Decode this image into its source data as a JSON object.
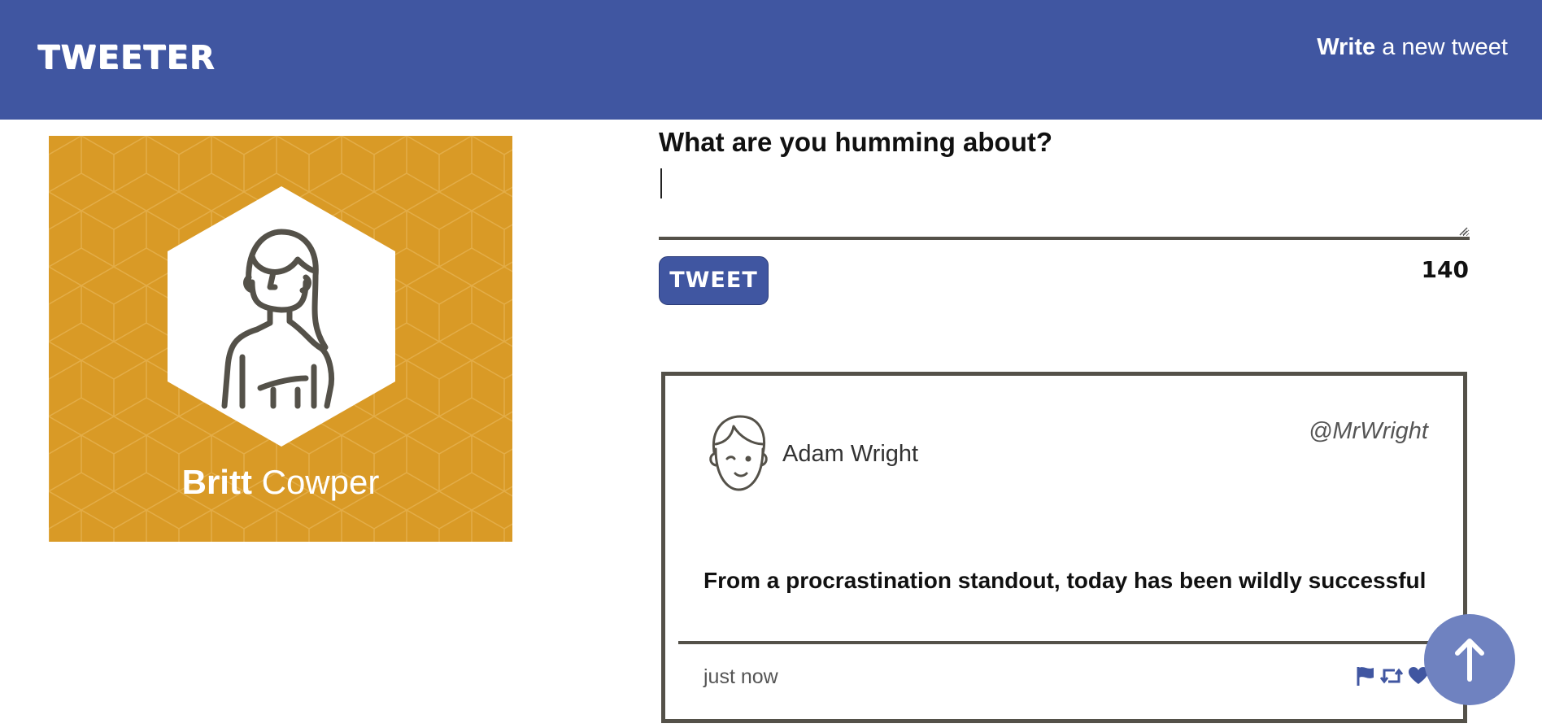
{
  "navbar": {
    "brand": "TWEETER",
    "write_bold": "Write",
    "write_rest": " a new tweet",
    "background": "#4056a1"
  },
  "profile": {
    "first_name": "Britt",
    "last_name": " Cowper",
    "background": "#d99a26",
    "avatar_icon": "woman-avatar-icon"
  },
  "compose": {
    "label": "What are you humming about?",
    "value": "",
    "button_label": "TWEET",
    "counter": "140"
  },
  "tweet": {
    "name": "Adam Wright",
    "handle": "@MrWright",
    "text": "From a procrastination standout, today has been wildly successful",
    "time": "just now",
    "avatar_icon": "man-avatar-icon",
    "actions": [
      "flag-icon",
      "retweet-icon",
      "heart-icon"
    ]
  },
  "scroll_top": {
    "icon": "arrow-up-icon",
    "color": "#6f82c0"
  }
}
